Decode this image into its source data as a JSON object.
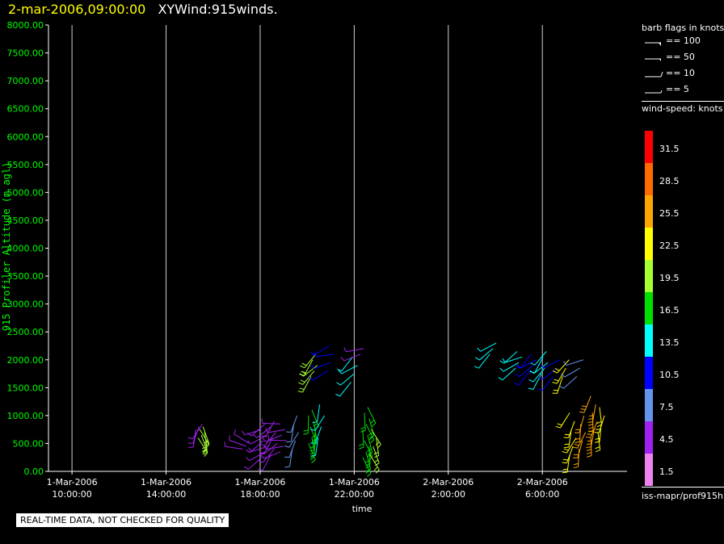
{
  "header": {
    "timestamp": "2-mar-2006,09:00:00",
    "product": "XYWind:915winds."
  },
  "legend": {
    "barb_title": "barb flags in knots",
    "barb_items": [
      "== 100",
      "== 50",
      "== 10",
      "== 5"
    ],
    "speed_title": "wind-speed: knots",
    "speed_levels": [
      {
        "label": "31.5",
        "color": "#ff0000"
      },
      {
        "label": "28.5",
        "color": "#ff6a00"
      },
      {
        "label": "25.5",
        "color": "#ffa500"
      },
      {
        "label": "22.5",
        "color": "#ffff00"
      },
      {
        "label": "19.5",
        "color": "#a8ff30"
      },
      {
        "label": "16.5",
        "color": "#00e000"
      },
      {
        "label": "13.5",
        "color": "#00ffff"
      },
      {
        "label": "10.5",
        "color": "#0000ff"
      },
      {
        "label": "7.5",
        "color": "#6495ed"
      },
      {
        "label": "4.5",
        "color": "#a020f0"
      },
      {
        "label": "1.5",
        "color": "#ee82ee"
      }
    ],
    "source": "iss-mapr/prof915h"
  },
  "footer": {
    "quality_note": "REAL-TIME DATA, NOT CHECKED FOR QUALITY"
  },
  "chart_data": {
    "type": "scatter",
    "xlabel": "time",
    "ylabel": "915 Profiler Altitude (m agl)",
    "xlim": [
      9.0,
      33.6
    ],
    "ylim": [
      0,
      8000
    ],
    "y_ticks": [
      "0.00",
      "500.00",
      "1000.00",
      "1500.00",
      "2000.00",
      "2500.00",
      "3000.00",
      "3500.00",
      "4000.00",
      "4500.00",
      "5000.00",
      "5500.00",
      "6000.00",
      "6500.00",
      "7000.00",
      "7500.00",
      "8000.00"
    ],
    "x_ticks": [
      {
        "hour": 10,
        "date": "1-Mar-2006",
        "time": "10:00:00"
      },
      {
        "hour": 14,
        "date": "1-Mar-2006",
        "time": "14:00:00"
      },
      {
        "hour": 18,
        "date": "1-Mar-2006",
        "time": "18:00:00"
      },
      {
        "hour": 22,
        "date": "1-Mar-2006",
        "time": "22:00:00"
      },
      {
        "hour": 26,
        "date": "2-Mar-2006",
        "time": "2:00:00"
      },
      {
        "hour": 30,
        "date": "2-Mar-2006",
        "time": "6:00:00"
      }
    ],
    "clusters": [
      {
        "t": 15.4,
        "z": [
          750,
          800,
          850
        ],
        "speed": 3,
        "dir": 200
      },
      {
        "t": 15.5,
        "z": [
          600,
          650,
          700,
          750,
          800
        ],
        "speed": 19.5,
        "dir": 160
      },
      {
        "t": 17.4,
        "z": [
          400,
          450,
          500
        ],
        "speed": 3,
        "dir": 290
      },
      {
        "t": 18.2,
        "z": [
          250,
          350,
          450,
          550,
          650,
          750,
          850
        ],
        "speed": 3,
        "dir": 240
      },
      {
        "t": 18.6,
        "z": [
          300,
          400,
          500,
          600,
          700,
          800,
          900
        ],
        "speed": 4.5,
        "dir": 220
      },
      {
        "t": 19.0,
        "z": [
          350,
          450,
          550,
          650,
          750,
          850
        ],
        "speed": 3,
        "dir": 260
      },
      {
        "t": 19.5,
        "z": [
          400,
          550,
          700,
          850,
          1000
        ],
        "speed": 7,
        "dir": 200
      },
      {
        "t": 20.2,
        "z": [
          500,
          600,
          700,
          800,
          900,
          1000,
          1100
        ],
        "speed": 16.5,
        "dir": 170
      },
      {
        "t": 20.6,
        "z": [
          600,
          800,
          1000,
          1200
        ],
        "speed": 13.5,
        "dir": 200
      },
      {
        "t": 20.3,
        "z": [
          1700,
          1800,
          1900,
          2000,
          2100
        ],
        "speed": 19.5,
        "dir": 220
      },
      {
        "t": 21.0,
        "z": [
          1800,
          1950,
          2100,
          2250
        ],
        "speed": 10.5,
        "dir": 250
      },
      {
        "t": 22.0,
        "z": [
          1600,
          1750,
          1900,
          2050
        ],
        "speed": 13.5,
        "dir": 230
      },
      {
        "t": 22.4,
        "z": [
          2100,
          2200
        ],
        "speed": 3,
        "dir": 260
      },
      {
        "t": 22.5,
        "z": [
          250,
          350,
          450,
          550,
          650,
          750,
          850,
          950,
          1050,
          1150
        ],
        "speed": 17,
        "dir": 165
      },
      {
        "t": 22.8,
        "z": [
          300,
          450,
          600,
          750
        ],
        "speed": 20,
        "dir": 160
      },
      {
        "t": 27.9,
        "z": [
          2100,
          2200,
          2300
        ],
        "speed": 13.5,
        "dir": 230
      },
      {
        "t": 29.0,
        "z": [
          1850,
          1950,
          2050,
          2150
        ],
        "speed": 12,
        "dir": 240
      },
      {
        "t": 29.6,
        "z": [
          1800,
          1900,
          2000,
          2100
        ],
        "speed": 11,
        "dir": 230
      },
      {
        "t": 30.1,
        "z": [
          1750,
          1850,
          1950,
          2050,
          2150
        ],
        "speed": 13.5,
        "dir": 220
      },
      {
        "t": 30.6,
        "z": [
          1700,
          1850,
          2000
        ],
        "speed": 10.5,
        "dir": 230
      },
      {
        "t": 31.0,
        "z": [
          1700,
          1850,
          2000
        ],
        "speed": 22.5,
        "dir": 210
      },
      {
        "t": 31.6,
        "z": [
          1700,
          1850,
          2000
        ],
        "speed": 6,
        "dir": 240
      },
      {
        "t": 31.3,
        "z": [
          300,
          450,
          600,
          750,
          900,
          1050
        ],
        "speed": 22.5,
        "dir": 200
      },
      {
        "t": 31.7,
        "z": [
          400,
          550,
          700,
          850,
          1000
        ],
        "speed": 24,
        "dir": 195
      },
      {
        "t": 32.2,
        "z": [
          600,
          750,
          900,
          1050,
          1200,
          1350
        ],
        "speed": 25.5,
        "dir": 190
      },
      {
        "t": 32.5,
        "z": [
          700,
          850,
          1000,
          1150
        ],
        "speed": 23,
        "dir": 185
      }
    ]
  }
}
